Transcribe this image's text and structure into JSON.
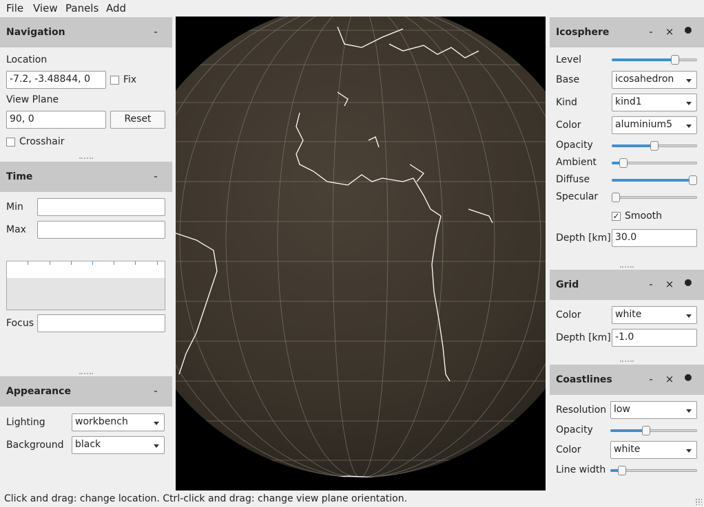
{
  "menu": [
    "File",
    "View",
    "Panels",
    "Add"
  ],
  "navigation": {
    "title": "Navigation",
    "collapse": "-",
    "location_label": "Location",
    "location_value": "-7.2, -3.48844, 0",
    "fix_label": "Fix",
    "fix_checked": false,
    "view_plane_label": "View Plane",
    "view_plane_value": "90, 0",
    "reset_label": "Reset",
    "crosshair_label": "Crosshair",
    "crosshair_checked": false
  },
  "time": {
    "title": "Time",
    "collapse": "-",
    "min_label": "Min",
    "min_value": "",
    "max_label": "Max",
    "max_value": "",
    "focus_label": "Focus",
    "focus_value": ""
  },
  "appearance": {
    "title": "Appearance",
    "collapse": "-",
    "lighting_label": "Lighting",
    "lighting_value": "workbench",
    "background_label": "Background",
    "background_value": "black"
  },
  "icosphere": {
    "title": "Icosphere",
    "minimize": "-",
    "close": "×",
    "level_label": "Level",
    "level_fraction": 0.77,
    "base_label": "Base",
    "base_value": "icosahedron",
    "kind_label": "Kind",
    "kind_value": "kind1",
    "color_label": "Color",
    "color_value": "aluminium5",
    "opacity_label": "Opacity",
    "opacity_fraction": 0.5,
    "ambient_label": "Ambient",
    "ambient_fraction": 0.1,
    "diffuse_label": "Diffuse",
    "diffuse_fraction": 1.0,
    "specular_label": "Specular",
    "specular_fraction": 0.0,
    "smooth_label": "Smooth",
    "smooth_checked": true,
    "depth_label": "Depth [km]",
    "depth_value": "30.0"
  },
  "grid": {
    "title": "Grid",
    "minimize": "-",
    "close": "×",
    "color_label": "Color",
    "color_value": "white",
    "depth_label": "Depth [km]",
    "depth_value": "-1.0"
  },
  "coastlines": {
    "title": "Coastlines",
    "minimize": "-",
    "close": "×",
    "resolution_label": "Resolution",
    "resolution_value": "low",
    "opacity_label": "Opacity",
    "opacity_fraction": 0.4,
    "color_label": "Color",
    "color_value": "white",
    "line_width_label": "Line width",
    "line_width_fraction": 0.1
  },
  "status": "Click and drag: change location. Ctrl-click and drag: change view plane orientation.",
  "colors": {
    "panel_header": "#c8c8c8",
    "globe_surface": "#3a342c",
    "viewport_background": "#000000",
    "accent": "#3d8fd6"
  }
}
